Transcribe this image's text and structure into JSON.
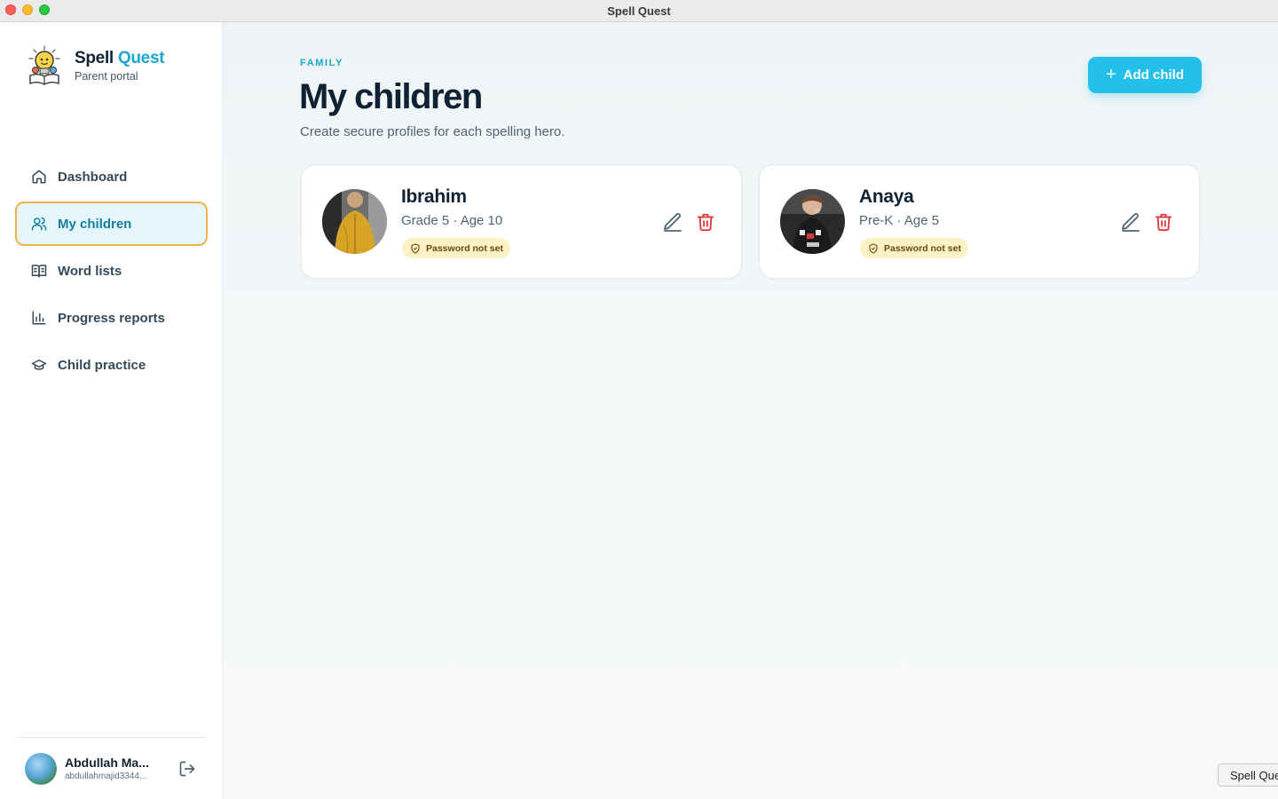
{
  "window": {
    "title": "Spell Quest"
  },
  "brand": {
    "name_part1": "Spell",
    "name_part2": "Quest",
    "subtitle": "Parent portal"
  },
  "nav": {
    "items": [
      {
        "label": "Dashboard",
        "icon": "home-icon",
        "active": false
      },
      {
        "label": "My children",
        "icon": "users-icon",
        "active": true
      },
      {
        "label": "Word lists",
        "icon": "book-icon",
        "active": false
      },
      {
        "label": "Progress reports",
        "icon": "bar-chart-icon",
        "active": false
      },
      {
        "label": "Child practice",
        "icon": "graduation-cap-icon",
        "active": false
      }
    ]
  },
  "user": {
    "name": "Abdullah Ma...",
    "email": "abdullahmajid3344..."
  },
  "header": {
    "eyebrow": "FAMILY",
    "title": "My children",
    "subtitle": "Create secure profiles for each spelling hero.",
    "add_label": "Add child"
  },
  "children": [
    {
      "name": "Ibrahim",
      "meta": "Grade 5 · Age 10",
      "badge": "Password not set"
    },
    {
      "name": "Anaya",
      "meta": "Pre-K · Age 5",
      "badge": "Password not set"
    }
  ],
  "tooltip": {
    "text": "Spell Quest"
  },
  "colors": {
    "accent": "#22c0ea",
    "brand_accent": "#1aa6cf",
    "active_border": "#f0b24a",
    "badge_bg": "#fdf1c6",
    "delete": "#e0343b"
  }
}
